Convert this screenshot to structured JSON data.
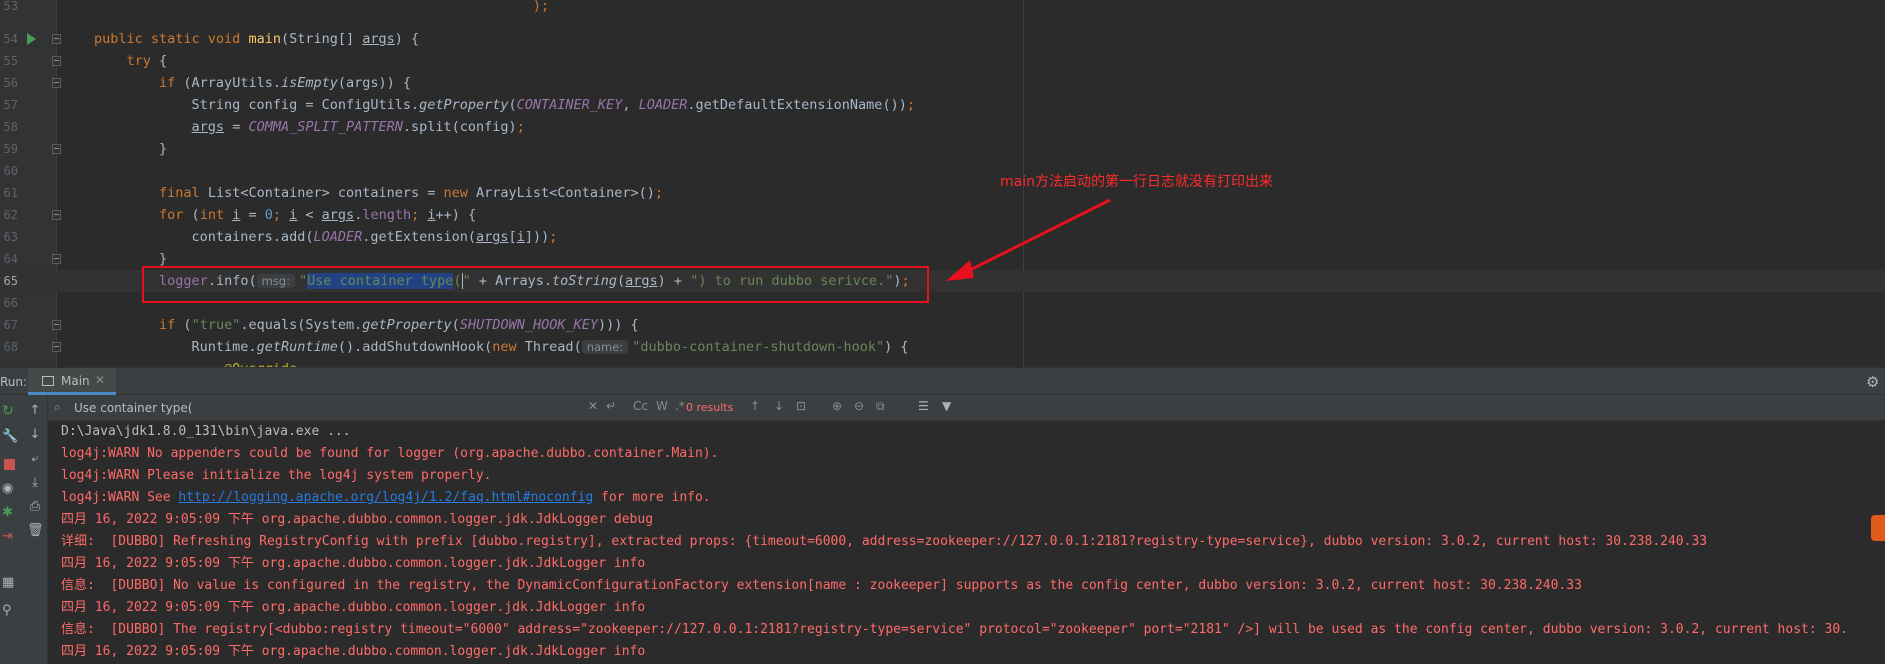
{
  "editor": {
    "lines": [
      {
        "num": "53"
      },
      {
        "num": "54"
      },
      {
        "num": "55"
      },
      {
        "num": "56"
      },
      {
        "num": "57"
      },
      {
        "num": "58"
      },
      {
        "num": "59"
      },
      {
        "num": "60"
      },
      {
        "num": "61"
      },
      {
        "num": "62"
      },
      {
        "num": "63"
      },
      {
        "num": "64"
      },
      {
        "num": "65"
      },
      {
        "num": "66"
      },
      {
        "num": "67"
      },
      {
        "num": "68"
      }
    ],
    "annotation_text": "main方法启动的第一行日志就没有打印出来",
    "accent_color": "#e8101d"
  },
  "run_panel": {
    "label": "Run:",
    "tab_label": "Main",
    "search": {
      "value": "Use container type(",
      "results": "0 results"
    }
  },
  "console": {
    "lines": [
      {
        "text": "D:\\Java\\jdk1.8.0_131\\bin\\java.exe ...",
        "color": "#bbbbbb"
      },
      {
        "text": "log4j:WARN No appenders could be found for logger (org.apache.dubbo.container.Main).",
        "color": "#ff6b68"
      },
      {
        "text": "log4j:WARN Please initialize the log4j system properly.",
        "color": "#ff6b68"
      },
      {
        "text": "四月 16, 2022 9:05:09 下午 org.apache.dubbo.common.logger.jdk.JdkLogger debug",
        "color": "#ff6b68"
      },
      {
        "text": "详细:  [DUBBO] Refreshing RegistryConfig with prefix [dubbo.registry], extracted props: {timeout=6000, address=zookeeper://127.0.0.1:2181?registry-type=service}, dubbo version: 3.0.2, current host: 30.238.240.33",
        "color": "#ff6b68"
      },
      {
        "text": "四月 16, 2022 9:05:09 下午 org.apache.dubbo.common.logger.jdk.JdkLogger info",
        "color": "#ff6b68"
      },
      {
        "text": "信息:  [DUBBO] No value is configured in the registry, the DynamicConfigurationFactory extension[name : zookeeper] supports as the config center, dubbo version: 3.0.2, current host: 30.238.240.33",
        "color": "#ff6b68"
      },
      {
        "text": "四月 16, 2022 9:05:09 下午 org.apache.dubbo.common.logger.jdk.JdkLogger info",
        "color": "#ff6b68"
      },
      {
        "text": "信息:  [DUBBO] The registry[<dubbo:registry timeout=\"6000\" address=\"zookeeper://127.0.0.1:2181?registry-type=service\" protocol=\"zookeeper\" port=\"2181\" />] will be used as the config center, dubbo version: 3.0.2, current host: 30.",
        "color": "#ff6b68"
      },
      {
        "text": "四月 16, 2022 9:05:09 下午 org.apache.dubbo.common.logger.jdk.JdkLogger info",
        "color": "#ff6b68"
      }
    ],
    "log4j_see": {
      "prefix": "log4j:WARN See ",
      "link": "http://logging.apache.org/log4j/1.2/faq.html#noconfig",
      "suffix": " for more info."
    }
  },
  "icons": {
    "run": "run-gutter-icon",
    "settings": "gear-icon",
    "search": "search-icon",
    "filter": "filter-icon"
  }
}
